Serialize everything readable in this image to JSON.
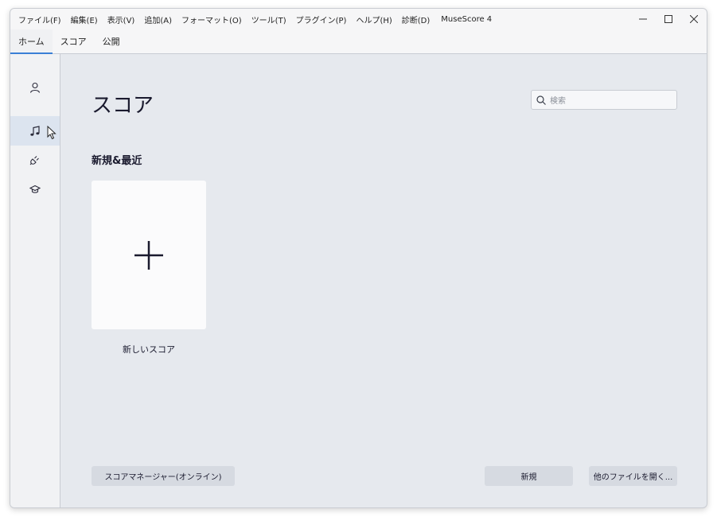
{
  "menu": [
    "ファイル(F)",
    "編集(E)",
    "表示(V)",
    "追加(A)",
    "フォーマット(O)",
    "ツール(T)",
    "プラグイン(P)",
    "ヘルプ(H)",
    "診断(D)"
  ],
  "app_title": "MuseScore 4",
  "tabs": [
    "ホーム",
    "スコア",
    "公開"
  ],
  "sidebar": {
    "items": [
      {
        "icon": "account-icon"
      },
      {
        "icon": "music-note-icon",
        "active": true
      },
      {
        "icon": "plugin-icon"
      },
      {
        "icon": "learn-icon"
      }
    ]
  },
  "main": {
    "title": "スコア",
    "search_placeholder": "検索",
    "section_title": "新規&最近",
    "new_score_label": "新しいスコア"
  },
  "buttons": {
    "score_manager": "スコアマネージャー(オンライン)",
    "new": "新規",
    "open_other": "他のファイルを開く..."
  },
  "colors": {
    "accent": "#3a7fd6",
    "background": "#e6e9ee",
    "sidebar_active": "#dce4ef"
  }
}
